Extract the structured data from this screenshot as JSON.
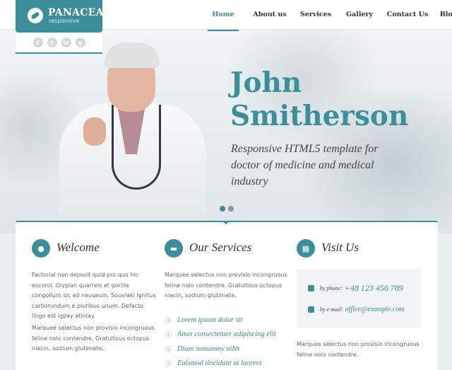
{
  "brand": {
    "name": "PANACEA",
    "tagline": "responsive"
  },
  "social": [
    {
      "icon": "facebook-icon",
      "glyph": "f"
    },
    {
      "icon": "twitter-icon",
      "glyph": "t"
    },
    {
      "icon": "linkedin-icon",
      "glyph": "in"
    },
    {
      "icon": "google-icon",
      "glyph": "g"
    }
  ],
  "nav": [
    {
      "label": "Home",
      "active": true
    },
    {
      "label": "About us",
      "active": false
    },
    {
      "label": "Services",
      "active": false
    },
    {
      "label": "Gallery",
      "active": false
    },
    {
      "label": "Contact Us",
      "active": false
    },
    {
      "label": "Blog",
      "active": false
    }
  ],
  "hero": {
    "name_line1": "John",
    "name_line2": "Smitherson",
    "tagline": "Responsive HTML5 template for doctor of medicine and medical industry",
    "slides": 2,
    "active_slide": 1
  },
  "welcome": {
    "title": "Welcome",
    "para1": "Factorial non deposit quid pro quo hic escorol. Olypian quarrels et gorilla congolium sic ad nauseum. Souvlaki ignitus carborundum e pluribus unum. Defacto lingo est igpay atinlay.",
    "para2": "Marquee selectus non provisio incongruous feline nolo contendre. Gratuitous octopus niacin, sodium glutimate."
  },
  "services": {
    "title": "Our Services",
    "para": "Marquee selectus non provisio incongruous feline nolo contendre. Gratuitous octopus niacin, sodium glutimate.",
    "items": [
      "Lorem ipsum dolor sit",
      "Amet consectetuer adipiscing elit",
      "Diam nonummy nibh",
      "Euismod tincidunt ut laoreet"
    ]
  },
  "visit": {
    "title": "Visit Us",
    "phone_label": "by phone:",
    "phone": "+48 123 456 789",
    "email_label": "by e-mail:",
    "email": "office@example.com",
    "para": "Marquee selectus non provisio incongruous feline nolo contendre."
  },
  "colors": {
    "accent": "#3b8e9a",
    "text": "#555555"
  }
}
